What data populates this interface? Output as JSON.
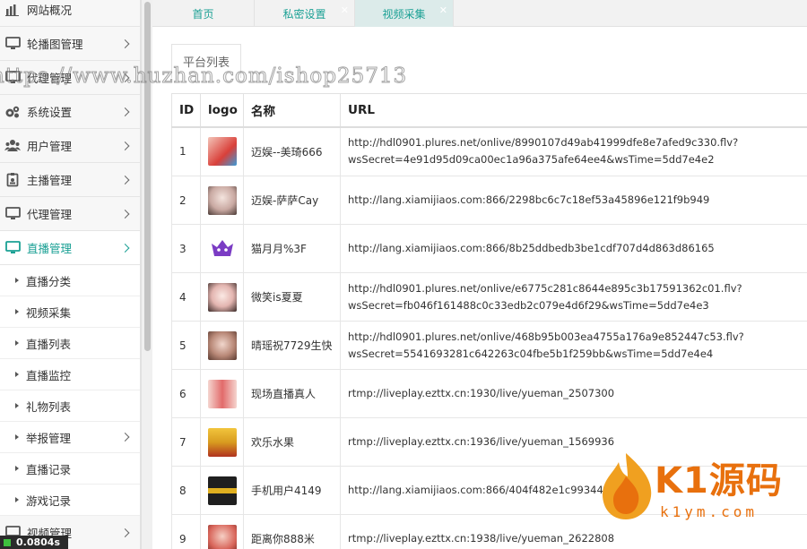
{
  "sidebar": {
    "items": [
      {
        "label": "网站概况",
        "icon": "bar-chart-icon"
      },
      {
        "label": "轮播图管理",
        "icon": "monitor-icon"
      },
      {
        "label": "代理管理",
        "icon": "monitor-icon"
      },
      {
        "label": "系统设置",
        "icon": "gears-icon"
      },
      {
        "label": "用户管理",
        "icon": "users-icon"
      },
      {
        "label": "主播管理",
        "icon": "badge-icon"
      },
      {
        "label": "代理管理",
        "icon": "monitor-icon"
      },
      {
        "label": "直播管理",
        "icon": "monitor-icon"
      }
    ],
    "sub_items": [
      "直播分类",
      "视频采集",
      "直播列表",
      "直播监控",
      "礼物列表",
      "举报管理",
      "直播记录",
      "游戏记录"
    ],
    "bottom_item": {
      "label": "视频管理",
      "icon": "monitor-icon"
    },
    "net_speed": "0.0804s"
  },
  "tabs": [
    {
      "label": "首页"
    },
    {
      "label": "私密设置"
    },
    {
      "label": "视频采集"
    }
  ],
  "platform_tab": "平台列表",
  "table": {
    "columns": [
      "ID",
      "logo",
      "名称",
      "URL"
    ],
    "rows": [
      {
        "id": "1",
        "name": "迈娱--美琦666",
        "url1": "http://hdl0901.plures.net/onlive/8990107d49ab41999dfe8e7afed9c330.flv?",
        "url2": "wsSecret=4e91d95d09ca00ec1a96a375afe64ee4&wsTime=5dd7e4e2",
        "logo_color": "#d9403a"
      },
      {
        "id": "2",
        "name": "迈娱-萨萨Cay",
        "url1": "http://lang.xiamijiaos.com:866/2298bc6c7c18ef53a45896e121f9b949",
        "url2": "",
        "logo_color": "#c9a9a2"
      },
      {
        "id": "3",
        "name": "猫月月%3F",
        "url1": "http://lang.xiamijiaos.com:866/8b25ddbedb3be1cdf707d4d863d86165",
        "url2": "",
        "logo_color": "#7b3cc4"
      },
      {
        "id": "4",
        "name": "微笑is夏夏",
        "url1": "http://hdl0901.plures.net/onlive/e6775c281c8644e895c3b17591362c01.flv?",
        "url2": "wsSecret=fb046f161488c0c33edb2c079e4d6f29&wsTime=5dd7e4e3",
        "logo_color": "#e3b5b0"
      },
      {
        "id": "5",
        "name": "晴瑶祝7729生快",
        "url1": "http://hdl0901.plures.net/onlive/468b95b003ea4755a176a9e852447c53.flv?",
        "url2": "wsSecret=5541693281c642263c04fbe5b1f259bb&wsTime=5dd7e4e4",
        "logo_color": "#b98978"
      },
      {
        "id": "6",
        "name": "现场直播真人",
        "url1": "rtmp://liveplay.ezttx.cn:1930/live/yueman_2507300",
        "url2": "",
        "logo_color": "#e26b6b"
      },
      {
        "id": "7",
        "name": "欢乐水果",
        "url1": "rtmp://liveplay.ezttx.cn:1936/live/yueman_1569936",
        "url2": "",
        "logo_color": "#d89b1f"
      },
      {
        "id": "8",
        "name": "手机用户4149",
        "url1": "http://lang.xiamijiaos.com:866/404f482e1c9934424b",
        "url2": "",
        "logo_color": "#1f1f1f"
      },
      {
        "id": "9",
        "name": "距离你888米",
        "url1": "rtmp://liveplay.ezttx.cn:1938/live/yueman_2622808",
        "url2": "",
        "logo_color": "#d8655a"
      }
    ]
  },
  "overlay": {
    "watermark": "https://www.huzhan.com/ishop25713",
    "brand_cn": "K1源码",
    "brand_url": "k1ym.com"
  },
  "colors": {
    "accent": "#1aa094",
    "brand": "#e8700d"
  }
}
